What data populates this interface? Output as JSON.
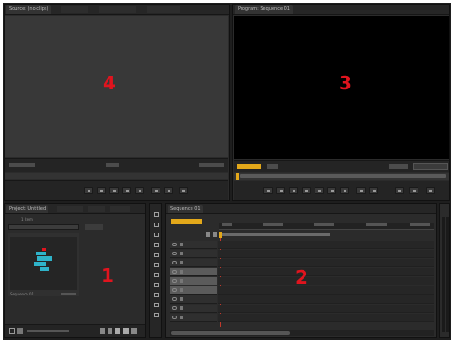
{
  "source_monitor": {
    "tab_label": "Source: (no clips)",
    "marker": "4"
  },
  "program_monitor": {
    "tab_label": "Program: Sequence 01",
    "marker": "3"
  },
  "project_panel": {
    "tab_label": "Project: Untitled",
    "item_count": "1 Item",
    "marker": "1",
    "clip_name": "Sequence 01"
  },
  "timeline": {
    "tab_label": "Sequence 01",
    "marker": "2"
  },
  "colors": {
    "marker": "#e0141e",
    "playhead": "#e3a81a",
    "panel_bg": "#2b2b2b",
    "program_screen": "#000000",
    "thumbnail_accent": "#2fb3c9"
  }
}
